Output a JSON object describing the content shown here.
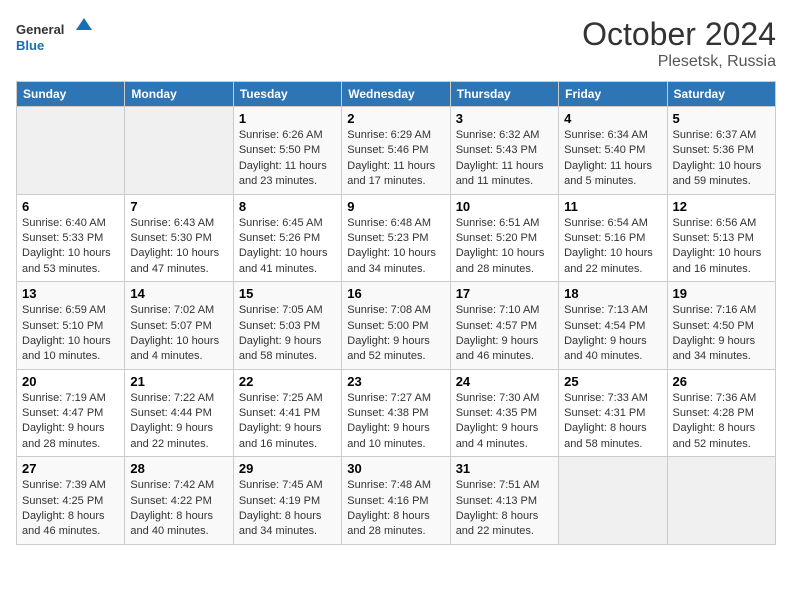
{
  "header": {
    "logo_text_general": "General",
    "logo_text_blue": "Blue",
    "month": "October 2024",
    "location": "Plesetsk, Russia"
  },
  "days_of_week": [
    "Sunday",
    "Monday",
    "Tuesday",
    "Wednesday",
    "Thursday",
    "Friday",
    "Saturday"
  ],
  "weeks": [
    [
      {
        "day": "",
        "info": ""
      },
      {
        "day": "",
        "info": ""
      },
      {
        "day": "1",
        "info": "Sunrise: 6:26 AM\nSunset: 5:50 PM\nDaylight: 11 hours and 23 minutes."
      },
      {
        "day": "2",
        "info": "Sunrise: 6:29 AM\nSunset: 5:46 PM\nDaylight: 11 hours and 17 minutes."
      },
      {
        "day": "3",
        "info": "Sunrise: 6:32 AM\nSunset: 5:43 PM\nDaylight: 11 hours and 11 minutes."
      },
      {
        "day": "4",
        "info": "Sunrise: 6:34 AM\nSunset: 5:40 PM\nDaylight: 11 hours and 5 minutes."
      },
      {
        "day": "5",
        "info": "Sunrise: 6:37 AM\nSunset: 5:36 PM\nDaylight: 10 hours and 59 minutes."
      }
    ],
    [
      {
        "day": "6",
        "info": "Sunrise: 6:40 AM\nSunset: 5:33 PM\nDaylight: 10 hours and 53 minutes."
      },
      {
        "day": "7",
        "info": "Sunrise: 6:43 AM\nSunset: 5:30 PM\nDaylight: 10 hours and 47 minutes."
      },
      {
        "day": "8",
        "info": "Sunrise: 6:45 AM\nSunset: 5:26 PM\nDaylight: 10 hours and 41 minutes."
      },
      {
        "day": "9",
        "info": "Sunrise: 6:48 AM\nSunset: 5:23 PM\nDaylight: 10 hours and 34 minutes."
      },
      {
        "day": "10",
        "info": "Sunrise: 6:51 AM\nSunset: 5:20 PM\nDaylight: 10 hours and 28 minutes."
      },
      {
        "day": "11",
        "info": "Sunrise: 6:54 AM\nSunset: 5:16 PM\nDaylight: 10 hours and 22 minutes."
      },
      {
        "day": "12",
        "info": "Sunrise: 6:56 AM\nSunset: 5:13 PM\nDaylight: 10 hours and 16 minutes."
      }
    ],
    [
      {
        "day": "13",
        "info": "Sunrise: 6:59 AM\nSunset: 5:10 PM\nDaylight: 10 hours and 10 minutes."
      },
      {
        "day": "14",
        "info": "Sunrise: 7:02 AM\nSunset: 5:07 PM\nDaylight: 10 hours and 4 minutes."
      },
      {
        "day": "15",
        "info": "Sunrise: 7:05 AM\nSunset: 5:03 PM\nDaylight: 9 hours and 58 minutes."
      },
      {
        "day": "16",
        "info": "Sunrise: 7:08 AM\nSunset: 5:00 PM\nDaylight: 9 hours and 52 minutes."
      },
      {
        "day": "17",
        "info": "Sunrise: 7:10 AM\nSunset: 4:57 PM\nDaylight: 9 hours and 46 minutes."
      },
      {
        "day": "18",
        "info": "Sunrise: 7:13 AM\nSunset: 4:54 PM\nDaylight: 9 hours and 40 minutes."
      },
      {
        "day": "19",
        "info": "Sunrise: 7:16 AM\nSunset: 4:50 PM\nDaylight: 9 hours and 34 minutes."
      }
    ],
    [
      {
        "day": "20",
        "info": "Sunrise: 7:19 AM\nSunset: 4:47 PM\nDaylight: 9 hours and 28 minutes."
      },
      {
        "day": "21",
        "info": "Sunrise: 7:22 AM\nSunset: 4:44 PM\nDaylight: 9 hours and 22 minutes."
      },
      {
        "day": "22",
        "info": "Sunrise: 7:25 AM\nSunset: 4:41 PM\nDaylight: 9 hours and 16 minutes."
      },
      {
        "day": "23",
        "info": "Sunrise: 7:27 AM\nSunset: 4:38 PM\nDaylight: 9 hours and 10 minutes."
      },
      {
        "day": "24",
        "info": "Sunrise: 7:30 AM\nSunset: 4:35 PM\nDaylight: 9 hours and 4 minutes."
      },
      {
        "day": "25",
        "info": "Sunrise: 7:33 AM\nSunset: 4:31 PM\nDaylight: 8 hours and 58 minutes."
      },
      {
        "day": "26",
        "info": "Sunrise: 7:36 AM\nSunset: 4:28 PM\nDaylight: 8 hours and 52 minutes."
      }
    ],
    [
      {
        "day": "27",
        "info": "Sunrise: 7:39 AM\nSunset: 4:25 PM\nDaylight: 8 hours and 46 minutes."
      },
      {
        "day": "28",
        "info": "Sunrise: 7:42 AM\nSunset: 4:22 PM\nDaylight: 8 hours and 40 minutes."
      },
      {
        "day": "29",
        "info": "Sunrise: 7:45 AM\nSunset: 4:19 PM\nDaylight: 8 hours and 34 minutes."
      },
      {
        "day": "30",
        "info": "Sunrise: 7:48 AM\nSunset: 4:16 PM\nDaylight: 8 hours and 28 minutes."
      },
      {
        "day": "31",
        "info": "Sunrise: 7:51 AM\nSunset: 4:13 PM\nDaylight: 8 hours and 22 minutes."
      },
      {
        "day": "",
        "info": ""
      },
      {
        "day": "",
        "info": ""
      }
    ]
  ]
}
